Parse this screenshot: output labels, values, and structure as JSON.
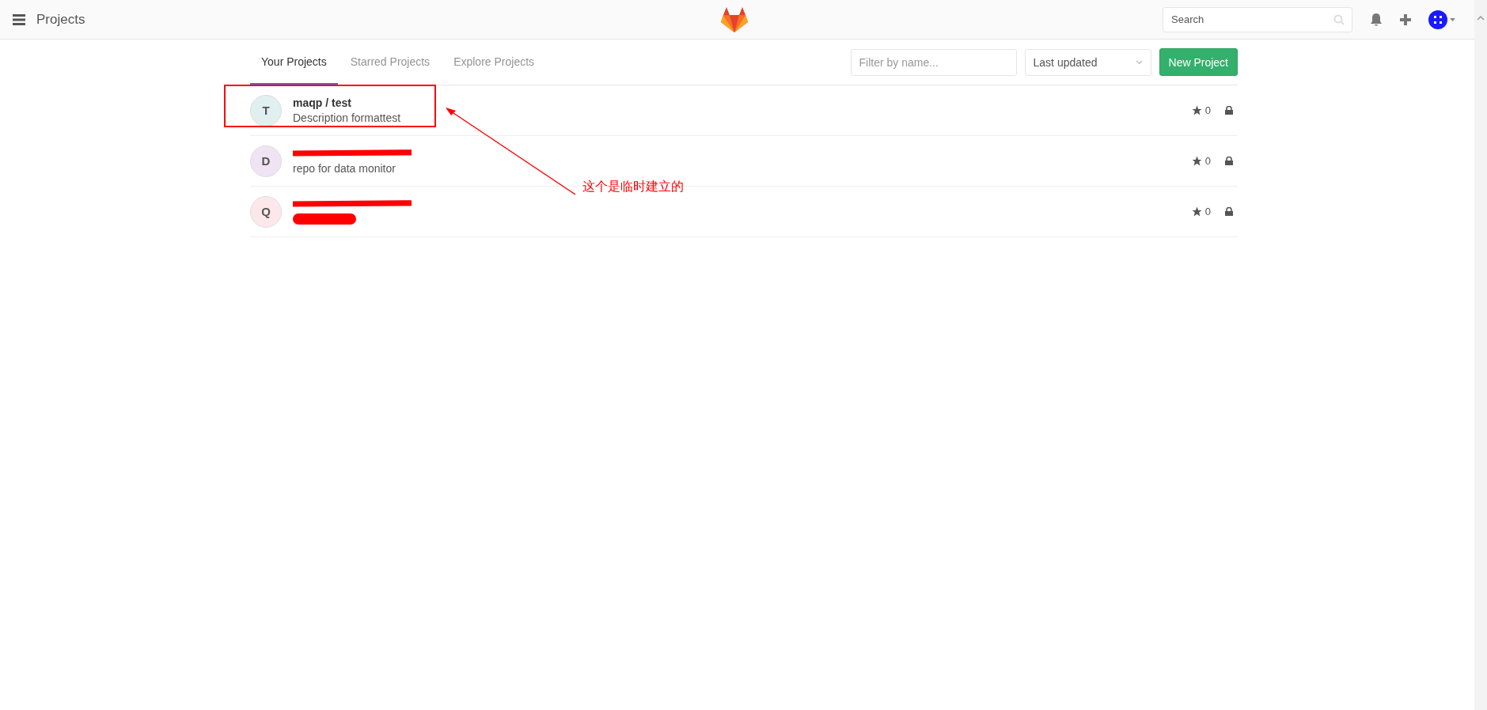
{
  "header": {
    "title": "Projects",
    "search": {
      "placeholder": "Search"
    }
  },
  "tabs": [
    {
      "label": "Your Projects",
      "selected": true
    },
    {
      "label": "Starred Projects",
      "selected": false
    },
    {
      "label": "Explore Projects",
      "selected": false
    }
  ],
  "filter": {
    "placeholder": "Filter by name..."
  },
  "sort": {
    "value": "Last updated"
  },
  "new_button": "New Project",
  "projects": [
    {
      "initial": "T",
      "color": "#e0f0f0",
      "name": "maqp / test",
      "description": "Description formattest",
      "redacted": false,
      "stars": "0",
      "private": true
    },
    {
      "initial": "D",
      "color": "#f0e4f4",
      "description": "repo for data monitor",
      "redacted": true,
      "stars": "0",
      "private": true
    },
    {
      "initial": "Q",
      "color": "#fce8ea",
      "redacted": true,
      "stars": "0",
      "private": true
    }
  ],
  "annotation": {
    "text": "这个是临时建立的"
  }
}
